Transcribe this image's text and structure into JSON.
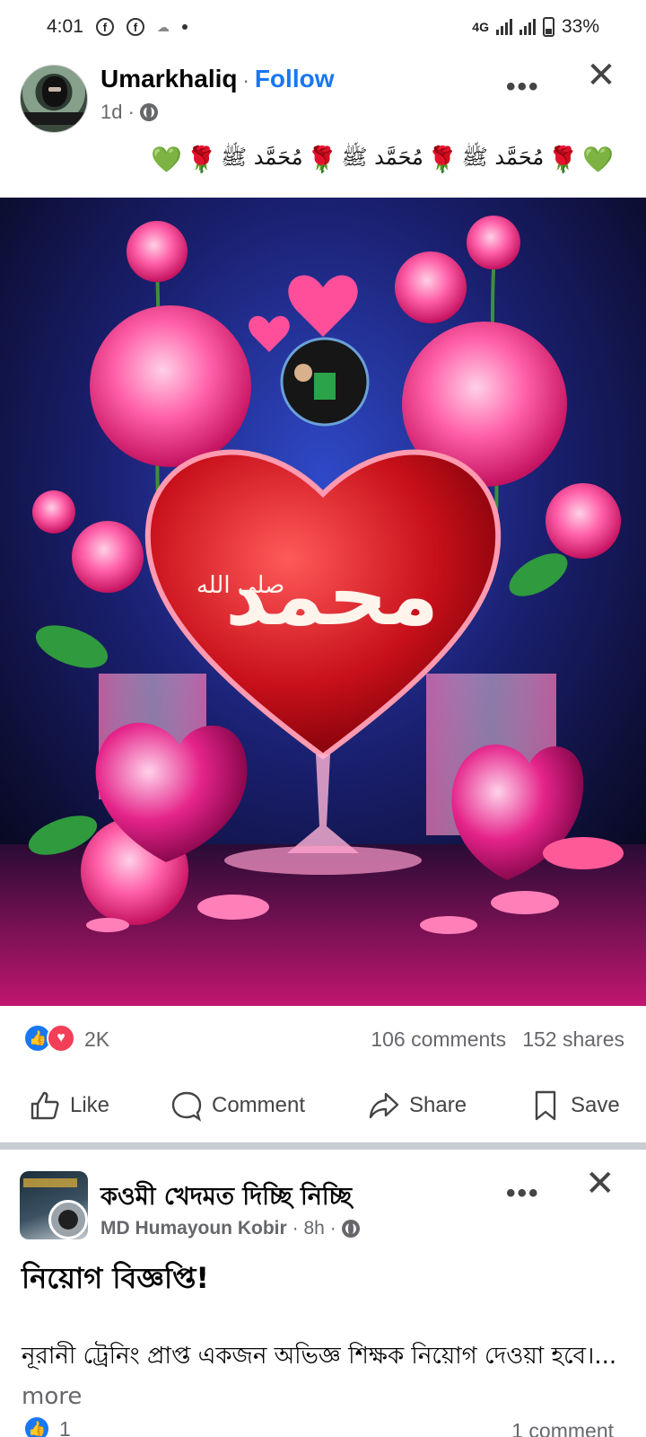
{
  "status_bar": {
    "time": "4:01",
    "network": "4G",
    "battery": "33%",
    "fb_icon": "f",
    "cloud_icon": "☁"
  },
  "post": {
    "author": "Umarkhaliq",
    "separator": "·",
    "follow": "Follow",
    "time": "1d ·",
    "more_icon": "•••",
    "close_icon": "✕",
    "caption": {
      "green_heart": "💚",
      "rose": "🌹",
      "arabic": "مُحَمَّد ﷺ"
    },
    "image": {
      "calligraphy": "محمد",
      "honorific": "صلى الله"
    },
    "reactions": {
      "count": "2K",
      "comments": "106 comments",
      "shares": "152 shares",
      "like_glyph": "👍",
      "love_glyph": "♥"
    },
    "actions": {
      "like": "Like",
      "comment": "Comment",
      "share": "Share",
      "save": "Save"
    }
  },
  "post2": {
    "title": "কওমী খেদমত দিচ্ছি নিচ্ছি",
    "author": "MD Humayoun Kobir",
    "time": "· 8h ·",
    "more_icon": "•••",
    "close_icon": "✕",
    "heading": "নিয়োগ বিজ্ঞপ্তি!",
    "body": "নূরানী ট্রেনিং প্রাপ্ত একজন অভিজ্ঞ শিক্ষক নিয়োগ দেওয়া হবে।...",
    "more": " more",
    "likes": "1",
    "comments": "1 comment"
  },
  "colors": {
    "accent": "#1877f2",
    "love": "#f33e58",
    "muted": "#65676b"
  }
}
